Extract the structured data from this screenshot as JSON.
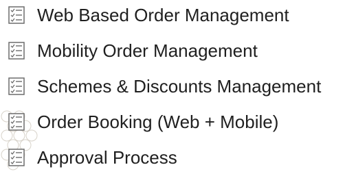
{
  "icon_name": "checklist-icon",
  "items": [
    {
      "label": "Web Based Order Management"
    },
    {
      "label": "Mobility Order Management"
    },
    {
      "label": "Schemes & Discounts Management"
    },
    {
      "label": "Order Booking (Web + Mobile)"
    },
    {
      "label": "Approval Process"
    }
  ],
  "colors": {
    "text": "#1f1f1f",
    "icon_stroke": "#6b6b6b",
    "watermark": "#c9c4ba"
  }
}
